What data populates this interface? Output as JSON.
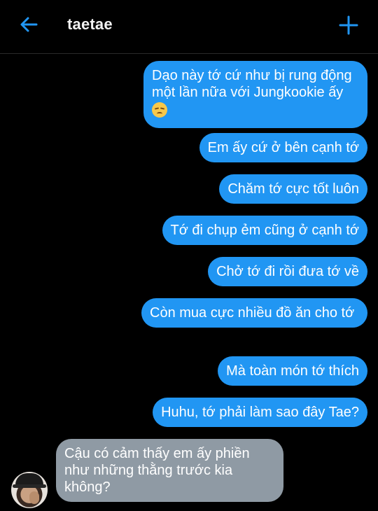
{
  "header": {
    "title": "taetae",
    "back_icon": "arrow-left-icon",
    "add_icon": "plus-icon",
    "accent_color": "#2196f3"
  },
  "messages": [
    {
      "direction": "sent",
      "text": "Dạo này tớ cứ như bị rung động một lần nữa với Jungkookie ấy",
      "emoji": "pensive-face"
    },
    {
      "direction": "sent",
      "text": "Em ấy cứ ở bên cạnh tớ"
    },
    {
      "direction": "sent",
      "text": "Chăm tớ cực tốt luôn"
    },
    {
      "direction": "sent",
      "text": "Tớ đi chụp ẻm cũng ở cạnh tớ"
    },
    {
      "direction": "sent",
      "text": "Chở tớ đi rồi đưa tớ về"
    },
    {
      "direction": "sent",
      "text": "Còn mua cực nhiều đồ ăn cho tớ"
    },
    {
      "direction": "sent",
      "text": "Mà toàn món tớ thích"
    },
    {
      "direction": "sent",
      "text": "Huhu, tớ phải làm sao đây Tae?"
    },
    {
      "direction": "received",
      "text": "Cậu có cảm thấy em ấy phiền như những thằng trước kia không?"
    }
  ],
  "colors": {
    "sent_bubble": "#2196f3",
    "received_bubble": "#8f9aa4",
    "background": "#000000"
  }
}
